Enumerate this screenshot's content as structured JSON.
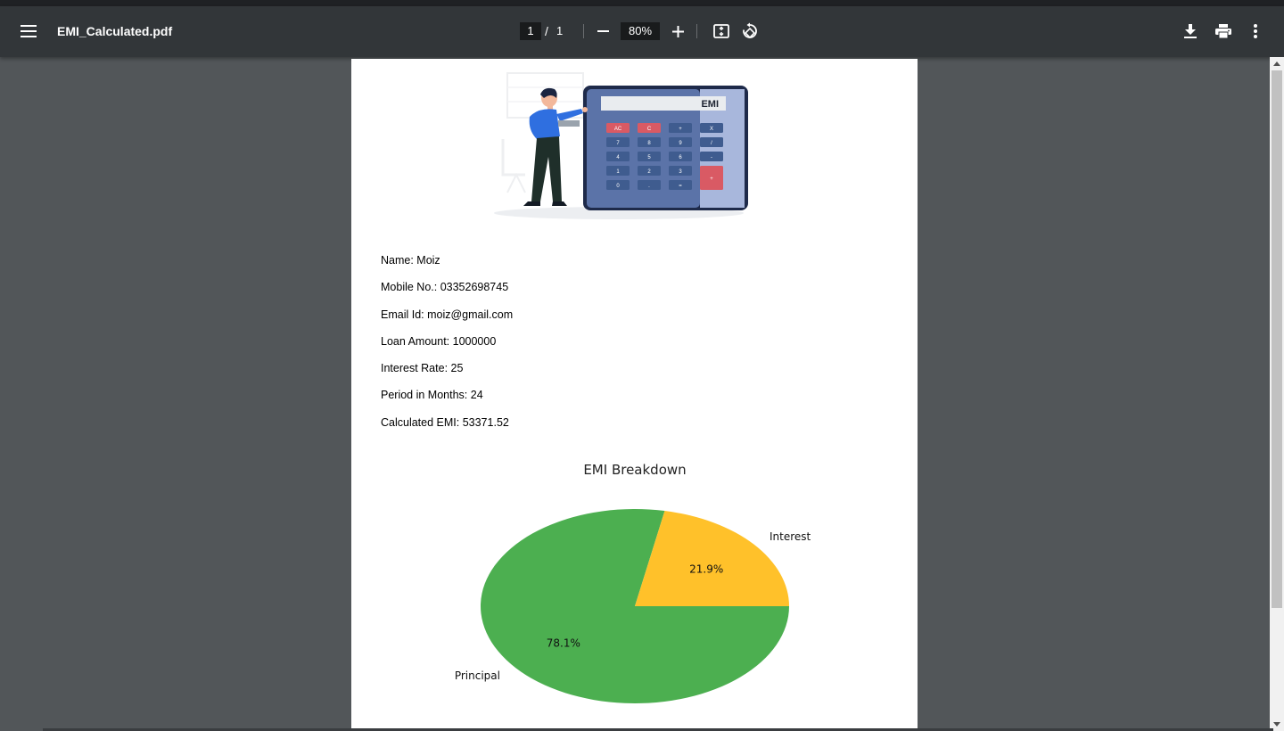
{
  "toolbar": {
    "file_name": "EMI_Calculated.pdf",
    "current_page": "1",
    "page_separator": "/",
    "total_pages": "1",
    "zoom": "80%",
    "icons": [
      "menu-icon",
      "zoom-out-icon",
      "zoom-in-icon",
      "fit-page-icon",
      "rotate-icon",
      "download-icon",
      "print-icon",
      "more-vert-icon"
    ]
  },
  "document": {
    "illustration_text": "EMI",
    "keypad": [
      "AC",
      "C",
      "+",
      "X",
      "7",
      "8",
      "9",
      "/",
      "4",
      "5",
      "6",
      "-",
      "1",
      "2",
      "3",
      "+",
      "0",
      ".",
      "="
    ],
    "fields": [
      "Name: Moiz",
      "Mobile No.: 03352698745",
      "Email Id: moiz@gmail.com",
      "Loan Amount: 1000000",
      "Interest Rate: 25",
      "Period in Months: 24",
      "Calculated EMI: 53371.52"
    ]
  },
  "chart_data": {
    "type": "pie",
    "title": "EMI Breakdown",
    "labels": [
      "Principal",
      "Interest"
    ],
    "values": [
      78.1,
      21.9
    ],
    "value_labels": [
      "78.1%",
      "21.9%"
    ],
    "colors": [
      "#4caf50",
      "#ffc12a"
    ],
    "start_angle_deg": 0,
    "direction": "clockwise"
  },
  "colors": {
    "toolbar_bg": "#323639",
    "viewer_bg": "#525659",
    "page_bg": "#ffffff"
  }
}
